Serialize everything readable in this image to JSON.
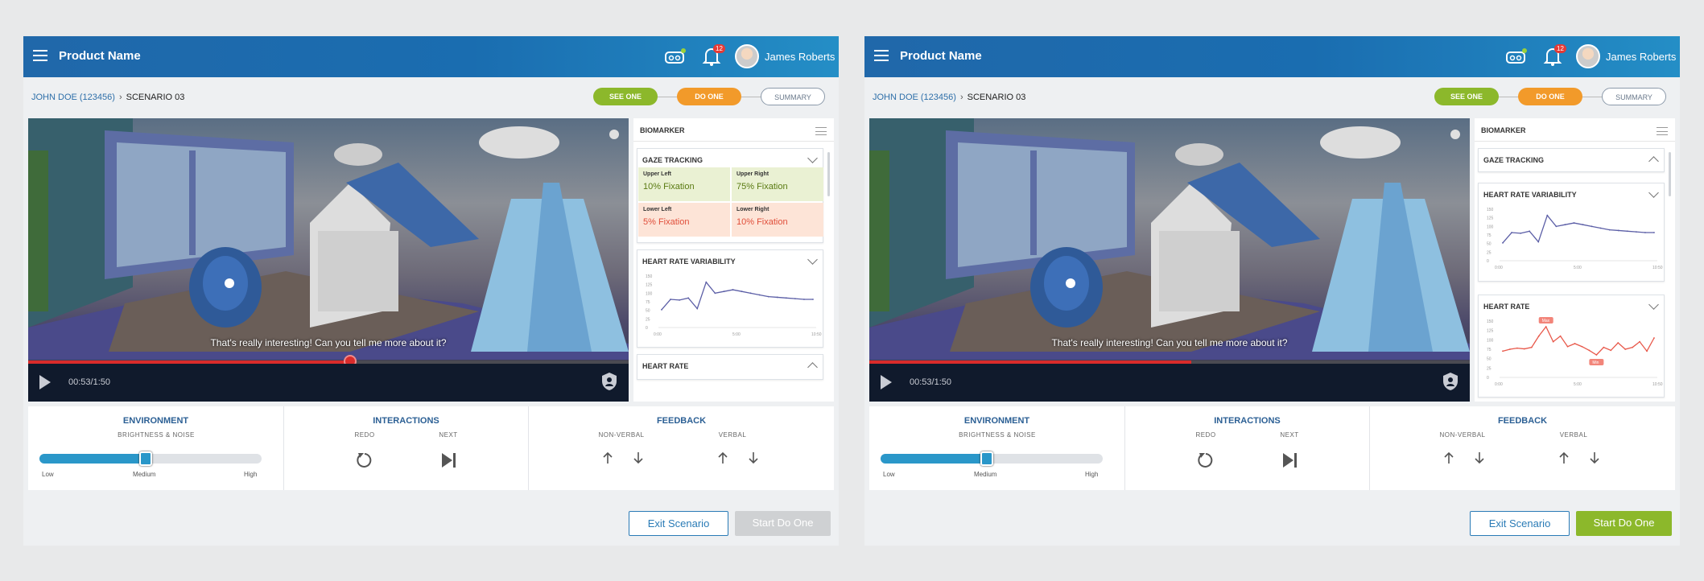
{
  "frames": [
    {
      "header": {
        "app_name": "Product Name",
        "notification_count": "12",
        "user_name": "James Roberts"
      },
      "breadcrumb": {
        "patient": "JOHN DOE (123456)",
        "scenario": "SCENARIO 03"
      },
      "steps": [
        "SEE ONE",
        "DO ONE",
        "SUMMARY"
      ],
      "video": {
        "subtitle": "That's really interesting! Can you tell me more about it?",
        "time": "00:53/1:50",
        "progress": 0.536
      },
      "biomarker": {
        "title": "BIOMARKER",
        "gaze": {
          "title": "GAZE TRACKING",
          "expanded": true,
          "cells": [
            {
              "label": "Upper Left",
              "value": "10% Fixation",
              "tone": "green"
            },
            {
              "label": "Upper Right",
              "value": "75% Fixation",
              "tone": "green"
            },
            {
              "label": "Lower Left",
              "value": "5% Fixation",
              "tone": "peach"
            },
            {
              "label": "Lower Right",
              "value": "10% Fixation",
              "tone": "peach"
            }
          ]
        },
        "hrv": {
          "title": "HEART RATE VARIABILITY",
          "yticks": [
            "150",
            "125",
            "100",
            "75",
            "50",
            "25",
            "0"
          ],
          "xticks": [
            "0:00",
            "5:00",
            "10:50"
          ],
          "values": [
            52,
            82,
            80,
            86,
            55,
            132,
            100,
            105,
            110,
            105,
            100,
            95,
            90,
            88,
            86,
            84,
            82,
            82
          ]
        },
        "hr": {
          "title": "HEART RATE",
          "expanded": false
        }
      },
      "environment": {
        "title": "ENVIRONMENT",
        "subtitle": "BRIGHTNESS & NOISE",
        "level": 0.48,
        "low": "Low",
        "medium": "Medium",
        "high": "High"
      },
      "interactions": {
        "title": "INTERACTIONS",
        "redo": "REDO",
        "next": "NEXT"
      },
      "feedback": {
        "title": "FEEDBACK",
        "nonverbal": "NON-VERBAL",
        "verbal": "VERBAL"
      },
      "actions": {
        "exit": "Exit Scenario",
        "start": "Start Do One",
        "start_enabled": false
      }
    },
    {
      "header": {
        "app_name": "Product Name",
        "notification_count": "12",
        "user_name": "James Roberts"
      },
      "breadcrumb": {
        "patient": "JOHN DOE (123456)",
        "scenario": "SCENARIO 03"
      },
      "steps": [
        "SEE ONE",
        "DO ONE",
        "SUMMARY"
      ],
      "video": {
        "subtitle": "That's really interesting! Can you tell me more about it?",
        "time": "00:53/1:50",
        "progress": 0.536
      },
      "biomarker": {
        "title": "BIOMARKER",
        "gaze": {
          "title": "GAZE TRACKING",
          "expanded": false
        },
        "hrv": {
          "title": "HEART RATE VARIABILITY",
          "yticks": [
            "150",
            "125",
            "100",
            "75",
            "50",
            "25",
            "0"
          ],
          "xticks": [
            "0:00",
            "5:00",
            "10:50"
          ],
          "values": [
            52,
            82,
            80,
            86,
            55,
            132,
            100,
            105,
            110,
            105,
            100,
            95,
            90,
            88,
            86,
            84,
            82,
            82
          ]
        },
        "hr": {
          "title": "HEART RATE",
          "expanded": true,
          "yticks": [
            "150",
            "125",
            "100",
            "75",
            "50",
            "25",
            "0"
          ],
          "xticks": [
            "0:00",
            "5:00",
            "10:50"
          ],
          "max_label": "Max",
          "min_label": "Min",
          "values": [
            70,
            75,
            78,
            76,
            80,
            110,
            135,
            95,
            110,
            82,
            90,
            82,
            72,
            60,
            80,
            72,
            92,
            75,
            80,
            95,
            70,
            105
          ]
        }
      },
      "environment": {
        "title": "ENVIRONMENT",
        "subtitle": "BRIGHTNESS & NOISE",
        "level": 0.48,
        "low": "Low",
        "medium": "Medium",
        "high": "High"
      },
      "interactions": {
        "title": "INTERACTIONS",
        "redo": "REDO",
        "next": "NEXT"
      },
      "feedback": {
        "title": "FEEDBACK",
        "nonverbal": "NON-VERBAL",
        "verbal": "VERBAL"
      },
      "actions": {
        "exit": "Exit Scenario",
        "start": "Start Do One",
        "start_enabled": true
      }
    }
  ],
  "colors": {
    "header": "#1a6db0",
    "see_one": "#8cb82b",
    "do_one": "#f29a2a",
    "accent": "#2a97c9",
    "hrv_line": "#5b5ea6",
    "hr_line": "#e8584a"
  }
}
